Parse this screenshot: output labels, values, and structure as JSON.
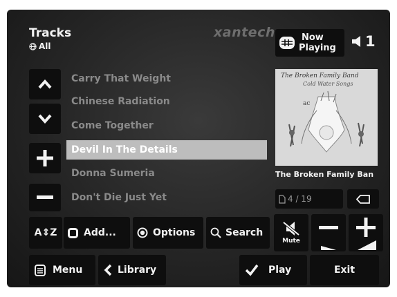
{
  "header": {
    "title": "Tracks",
    "filter_label": "All",
    "brand": "xantech",
    "now_playing_label": "Now Playing",
    "now_playing_line1": "Now",
    "now_playing_line2": "Playing",
    "volume_zone": "1"
  },
  "tracks": [
    {
      "title": "Carry That Weight",
      "selected": false
    },
    {
      "title": "Chinese Radiation",
      "selected": false
    },
    {
      "title": "Come Together",
      "selected": false
    },
    {
      "title": "Devil In The Details",
      "selected": true
    },
    {
      "title": "Donna Sumeria",
      "selected": false
    },
    {
      "title": "Don't Die Just Yet",
      "selected": false
    }
  ],
  "album": {
    "artist_caption": "The Broken Family Ban",
    "art_text_line1": "The Broken Family Band",
    "art_text_line2": "Cold Water Songs"
  },
  "pager": {
    "position": "4 / 19"
  },
  "toolbar": {
    "sort_label": "A⇕Z",
    "add_label": "Add...",
    "options_label": "Options",
    "search_label": "Search",
    "mute_label": "Mute"
  },
  "bottom": {
    "menu_label": "Menu",
    "library_label": "Library",
    "play_label": "Play",
    "exit_label": "Exit"
  },
  "colors": {
    "selected_row": "#bdbdbd",
    "button_bg": "#0e0e0e",
    "panel_bg": "#2a2a2a",
    "dim_text": "#8a8a8a"
  }
}
